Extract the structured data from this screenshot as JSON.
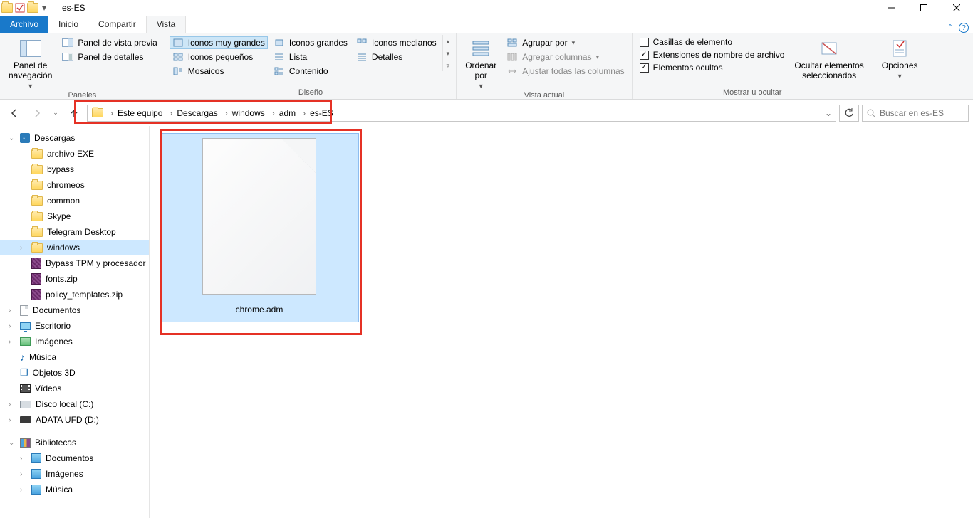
{
  "window": {
    "title": "es-ES"
  },
  "tabs": {
    "file": "Archivo",
    "inicio": "Inicio",
    "compartir": "Compartir",
    "vista": "Vista"
  },
  "ribbon": {
    "paneles": {
      "nav": "Panel de\nnavegación",
      "preview": "Panel de vista previa",
      "details": "Panel de detalles",
      "caption": "Paneles"
    },
    "diseno": {
      "xl": "Iconos muy grandes",
      "lg": "Iconos grandes",
      "md": "Iconos medianos",
      "sm": "Iconos pequeños",
      "list": "Lista",
      "det": "Detalles",
      "tiles": "Mosaicos",
      "content": "Contenido",
      "caption": "Diseño"
    },
    "vistaactual": {
      "sort": "Ordenar\npor",
      "group": "Agrupar por",
      "addcols": "Agregar columnas",
      "sizeall": "Ajustar todas las columnas",
      "caption": "Vista actual"
    },
    "mostrar": {
      "chk_boxes": "Casillas de elemento",
      "chk_ext": "Extensiones de nombre de archivo",
      "chk_hidden": "Elementos ocultos",
      "hidebtn": "Ocultar elementos\nseleccionados",
      "caption": "Mostrar u ocultar"
    },
    "opciones": "Opciones"
  },
  "breadcrumbs": [
    "Este equipo",
    "Descargas",
    "windows",
    "adm",
    "es-ES"
  ],
  "search": {
    "placeholder": "Buscar en es-ES"
  },
  "tree": {
    "descargas": "Descargas",
    "items1": [
      "archivo EXE",
      "bypass",
      "chromeos",
      "common",
      "Skype",
      "Telegram Desktop",
      "windows"
    ],
    "rar": [
      "Bypass TPM y procesador",
      "fonts.zip",
      "policy_templates.zip"
    ],
    "docs": "Documentos",
    "escritorio": "Escritorio",
    "imagenes": "Imágenes",
    "musica": "Música",
    "obj3d": "Objetos 3D",
    "videos": "Vídeos",
    "disco": "Disco local (C:)",
    "usb": "ADATA UFD (D:)",
    "biblio": "Bibliotecas",
    "b_docs": "Documentos",
    "b_img": "Imágenes",
    "b_mus": "Música"
  },
  "file": {
    "name": "chrome.adm"
  }
}
